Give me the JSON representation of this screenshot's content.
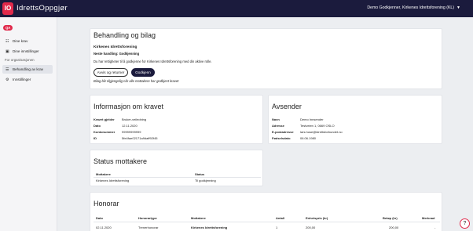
{
  "app": {
    "logo": "IO",
    "brand": "IdrettsOppgjør",
    "account": "Demo Godkjenner, Kirkenes Idrettsforening (KL)"
  },
  "sidebar": {
    "badge": "QA",
    "items": [
      {
        "label": "Dine krav",
        "icon": "users-icon"
      },
      {
        "label": "Dine innstillinger",
        "icon": "settings-card-icon"
      }
    ],
    "section_label": "For organisasjonen",
    "org_items": [
      {
        "label": "Behandling av krav",
        "icon": "list-icon",
        "active": true
      },
      {
        "label": "Innstillinger",
        "icon": "gear-icon"
      }
    ]
  },
  "behandling": {
    "title": "Behandling og bilag",
    "org": "Kirkenes Idrettsforening",
    "next_action": "Neste handling: Godkjenning",
    "rights": "Du har rettigheter til å godkjenne for Kirkenes Idrettsforening med din aktive rolle.",
    "reject_label": "Avvis og returner",
    "approve_label": "Godkjenn",
    "note": "Bilag blir tilgjengelig når alle mottakere har godkjent kravet"
  },
  "kravet": {
    "title": "Informasjon om kravet",
    "rows": [
      {
        "key": "Kravet gjelder",
        "value": "Bruker-veiledning"
      },
      {
        "key": "Dato",
        "value": "12.11.2020"
      },
      {
        "key": "Kontonummer",
        "value": "99999999999"
      },
      {
        "key": "ID",
        "value": "5fe4fae02171a9daff92f45"
      }
    ]
  },
  "avsender": {
    "title": "Avsender",
    "rows": [
      {
        "key": "Navn",
        "value": "Demo Innsender"
      },
      {
        "key": "Adresse",
        "value": "Testveien 1, 0669 OSLO"
      },
      {
        "key": "E-postadresse",
        "value": "lars.huse@idrettsforbundet.no"
      },
      {
        "key": "Fødselsdato",
        "value": "06.06.1980"
      }
    ]
  },
  "status": {
    "title": "Status mottakere",
    "headers": [
      "Mottakere",
      "Status"
    ],
    "rows": [
      [
        "Kirkenes Idrettsforening",
        "Til godkjenning"
      ]
    ]
  },
  "honorar": {
    "title": "Honorar",
    "headers": [
      "Dato",
      "Honorartype",
      "Mottakere",
      "Antall",
      "Enhetspris (kr)",
      "Beløp (kr)",
      "Merknad"
    ],
    "rows": [
      [
        "02.11.2020",
        "Trenerhonorar",
        "Kirkenes Idrettsforening",
        "1",
        "200,00",
        "200,00",
        "-"
      ]
    ]
  },
  "help": "?"
}
